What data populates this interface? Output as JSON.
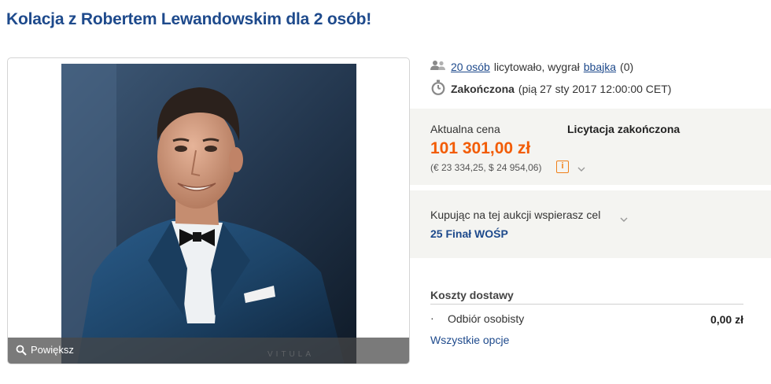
{
  "page": {
    "title": "Kolacja z Robertem Lewandowskim dla 2 osób!"
  },
  "gallery": {
    "zoom_label": "Powiększ",
    "watermark": "VITULA"
  },
  "bids": {
    "count_link": "20 osób",
    "text": "licytowało, wygrał",
    "winner": "bbajka",
    "winner_rating": "(0)"
  },
  "status": {
    "label": "Zakończona",
    "date": "(pią 27 sty 2017 12:00:00 CET)"
  },
  "price": {
    "label": "Aktualna cena",
    "value": "101 301,00 zł",
    "converted": "(€ 23 334,25, $ 24 954,06)",
    "auction_status": "Licytacja zakończona"
  },
  "charity": {
    "text": "Kupując na tej aukcji wspierasz cel",
    "link": "25 Finał WOŚP"
  },
  "shipping": {
    "title": "Koszty dostawy",
    "options": [
      {
        "name": "Odbiór osobisty",
        "price": "0,00 zł"
      }
    ],
    "all_options": "Wszystkie opcje"
  },
  "icons": {
    "people": "people-icon",
    "clock": "stopwatch-icon",
    "info": "info-icon",
    "search": "search-icon",
    "chevron": "chevron-down-icon"
  },
  "colors": {
    "title_blue": "#1e4a8c",
    "price_orange": "#f25c05",
    "panel_bg": "#f4f4f1"
  }
}
